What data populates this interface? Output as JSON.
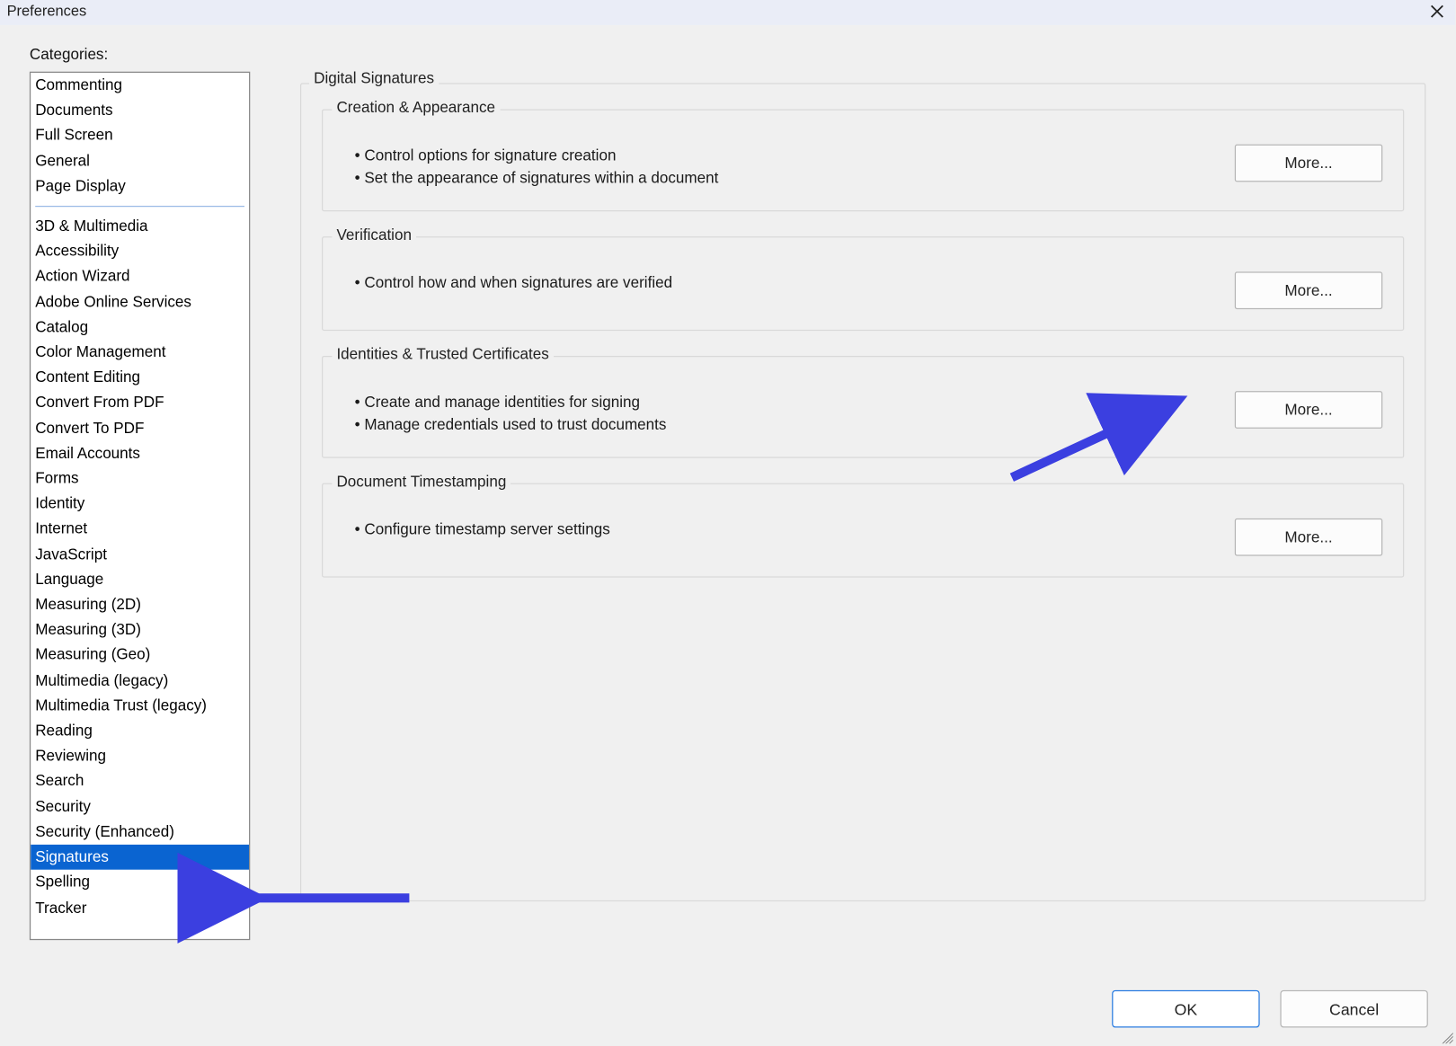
{
  "window": {
    "title": "Preferences"
  },
  "categories_label": "Categories:",
  "categories": {
    "group1": [
      "Commenting",
      "Documents",
      "Full Screen",
      "General",
      "Page Display"
    ],
    "group2": [
      "3D & Multimedia",
      "Accessibility",
      "Action Wizard",
      "Adobe Online Services",
      "Catalog",
      "Color Management",
      "Content Editing",
      "Convert From PDF",
      "Convert To PDF",
      "Email Accounts",
      "Forms",
      "Identity",
      "Internet",
      "JavaScript",
      "Language",
      "Measuring (2D)",
      "Measuring (3D)",
      "Measuring (Geo)",
      "Multimedia (legacy)",
      "Multimedia Trust (legacy)",
      "Reading",
      "Reviewing",
      "Search",
      "Security",
      "Security (Enhanced)",
      "Signatures",
      "Spelling",
      "Tracker"
    ],
    "selected": "Signatures"
  },
  "panel": {
    "title": "Digital Signatures",
    "groups": [
      {
        "title": "Creation & Appearance",
        "bullets": [
          "Control options for signature creation",
          "Set the appearance of signatures within a document"
        ],
        "button": "More..."
      },
      {
        "title": "Verification",
        "bullets": [
          "Control how and when signatures are verified"
        ],
        "button": "More..."
      },
      {
        "title": "Identities & Trusted Certificates",
        "bullets": [
          "Create and manage identities for signing",
          "Manage credentials used to trust documents"
        ],
        "button": "More..."
      },
      {
        "title": "Document Timestamping",
        "bullets": [
          "Configure timestamp server settings"
        ],
        "button": "More..."
      }
    ]
  },
  "buttons": {
    "ok": "OK",
    "cancel": "Cancel"
  }
}
